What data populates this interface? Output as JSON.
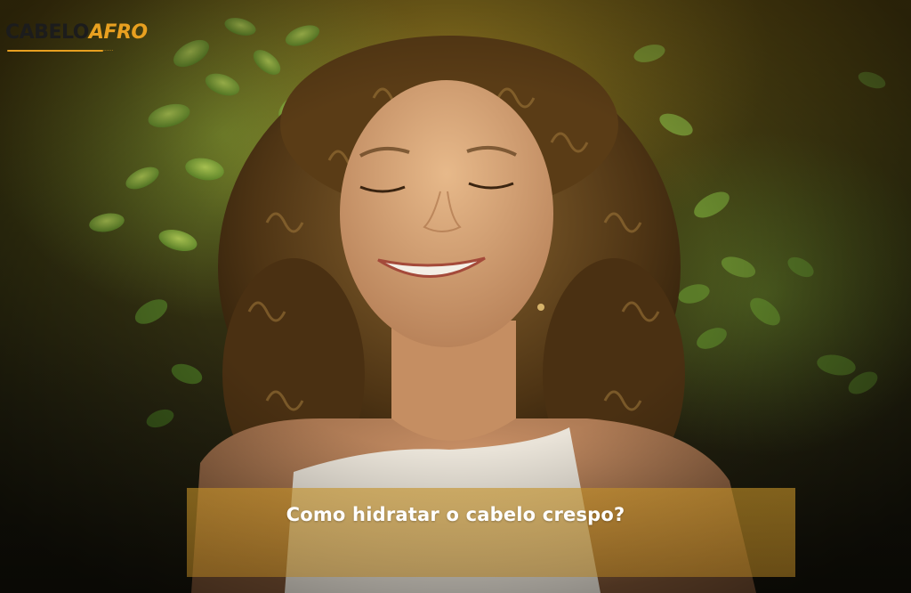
{
  "logo": {
    "part1": "CABELO",
    "part2": "AFRO",
    "tagline": "......"
  },
  "caption": {
    "text": "Como hidratar o cabelo crespo?"
  },
  "colors": {
    "accent": "#e8a020",
    "overlay": "#c4912a",
    "caption_text": "#ffffff"
  },
  "scene": {
    "subject": "smiling-woman-curly-hair-icon",
    "background": "green-leaves-icon"
  }
}
